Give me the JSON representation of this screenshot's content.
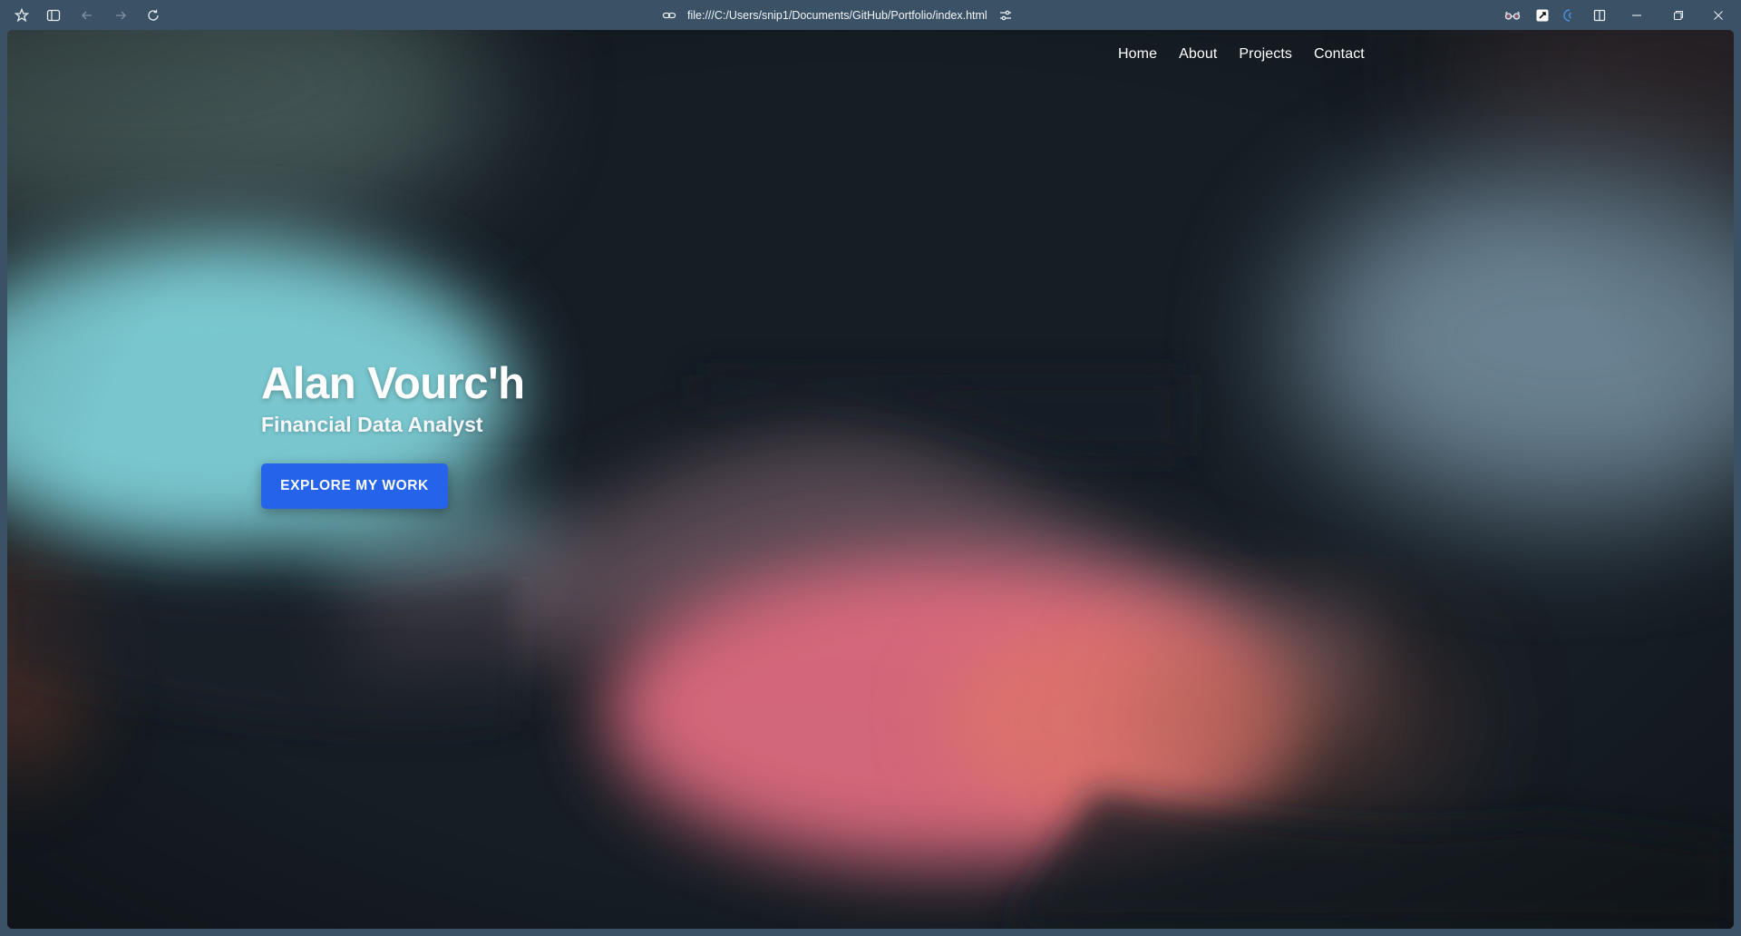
{
  "browser": {
    "url": "file:///C:/Users/snip1/Documents/GitHub/Portfolio/index.html",
    "icons": {
      "app_menu": "workspaces-icon",
      "sidebar": "sidebar-toggle-icon",
      "back": "back-arrow-icon",
      "forward": "forward-arrow-icon",
      "reload": "reload-icon",
      "link": "link-icon",
      "page_settings": "sliders-icon",
      "extension_1": "glasses-icon",
      "extension_2": "notion-icon",
      "extension_3": "bookmark-icon",
      "split_view": "split-view-icon",
      "minimize": "minimize-icon",
      "restore": "restore-icon",
      "close": "close-icon"
    }
  },
  "nav": {
    "items": [
      {
        "label": "Home"
      },
      {
        "label": "About"
      },
      {
        "label": "Projects"
      },
      {
        "label": "Contact"
      }
    ]
  },
  "hero": {
    "name": "Alan Vourc'h",
    "title": "Financial Data Analyst",
    "cta_label": "EXPLORE MY WORK"
  },
  "colors": {
    "chrome": "#3b5165",
    "page_bg": "#161d24",
    "cyan_glow": "#7fd0d8",
    "pink_glow": "#e06a80",
    "accent_button": "#2563eb"
  }
}
